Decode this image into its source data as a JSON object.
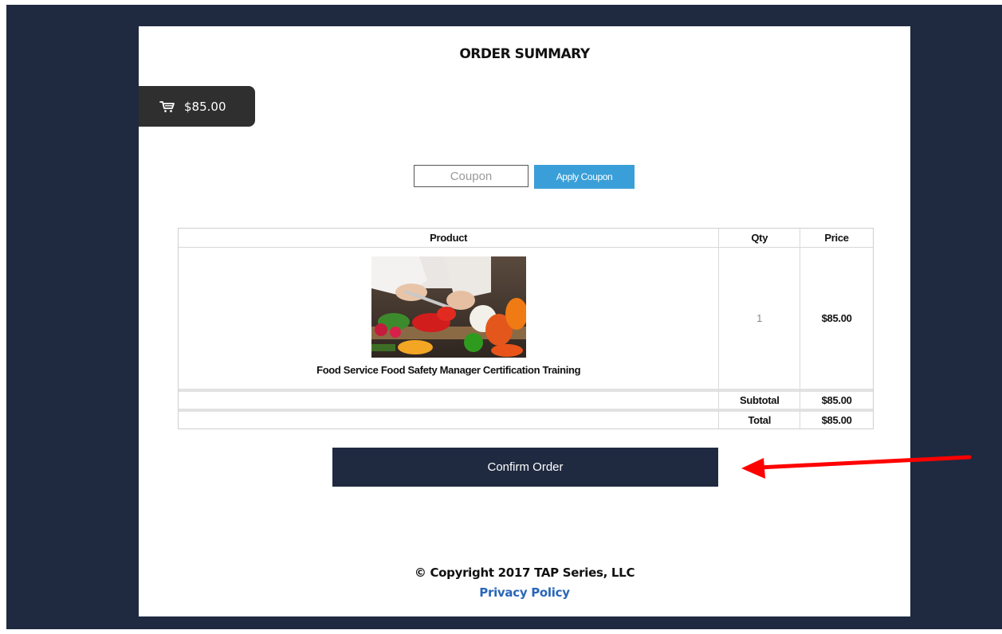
{
  "page": {
    "title": "ORDER SUMMARY"
  },
  "cart": {
    "icon": "cart-icon",
    "total": "$85.00"
  },
  "coupon": {
    "placeholder": "Coupon",
    "value": "",
    "apply_label": "Apply Coupon",
    "button_color": "#3a9fd8"
  },
  "table": {
    "headers": {
      "product": "Product",
      "qty": "Qty",
      "price": "Price"
    },
    "items": [
      {
        "name": "Food Service Food Safety Manager Certification Training",
        "qty": "1",
        "price": "$85.00",
        "image": "vegetables-cutting-photo"
      }
    ],
    "subtotal_label": "Subtotal",
    "subtotal_value": "$85.00",
    "total_label": "Total",
    "total_value": "$85.00"
  },
  "actions": {
    "confirm_label": "Confirm Order",
    "confirm_color": "#1f2a40"
  },
  "annotation": {
    "arrow_color": "#ff0000",
    "points_to": "confirm-order-button"
  },
  "footer": {
    "copyright": "© Copyright 2017 TAP Series, LLC",
    "privacy_label": "Privacy Policy",
    "privacy_color": "#2a66b8"
  }
}
